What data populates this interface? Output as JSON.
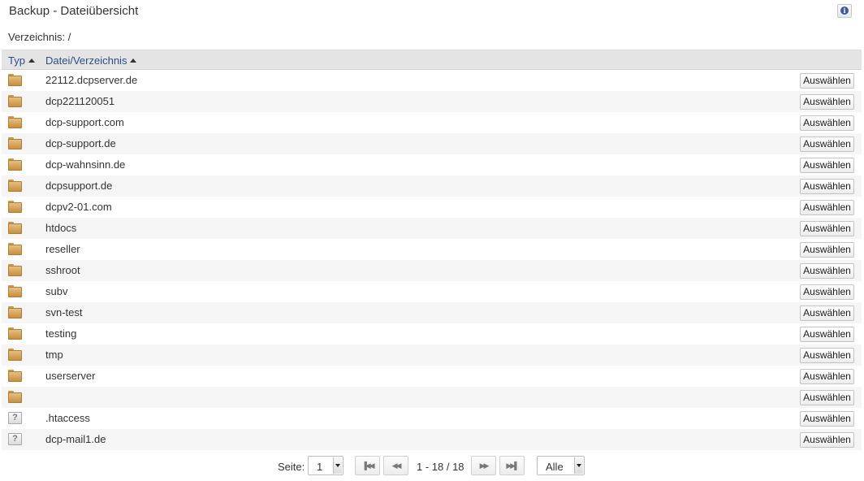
{
  "header": {
    "title": "Backup - Dateiübersicht",
    "info_icon": "info-icon"
  },
  "directory": {
    "text": "Verzeichnis: /"
  },
  "table": {
    "columns": [
      "Typ",
      "Datei/Verzeichnis"
    ],
    "rows": [
      {
        "type": "folder",
        "name": "22112.dcpserver.de",
        "action": "Auswählen"
      },
      {
        "type": "folder",
        "name": "dcp221120051",
        "action": "Auswählen"
      },
      {
        "type": "folder",
        "name": "dcp-support.com",
        "action": "Auswählen"
      },
      {
        "type": "folder",
        "name": "dcp-support.de",
        "action": "Auswählen"
      },
      {
        "type": "folder",
        "name": "dcp-wahnsinn.de",
        "action": "Auswählen"
      },
      {
        "type": "folder",
        "name": "dcpsupport.de",
        "action": "Auswählen"
      },
      {
        "type": "folder",
        "name": "dcpv2-01.com",
        "action": "Auswählen"
      },
      {
        "type": "folder",
        "name": "htdocs",
        "action": "Auswählen"
      },
      {
        "type": "folder",
        "name": "reseller",
        "action": "Auswählen"
      },
      {
        "type": "folder",
        "name": "sshroot",
        "action": "Auswählen"
      },
      {
        "type": "folder",
        "name": "subv",
        "action": "Auswählen"
      },
      {
        "type": "folder",
        "name": "svn-test",
        "action": "Auswählen"
      },
      {
        "type": "folder",
        "name": "testing",
        "action": "Auswählen"
      },
      {
        "type": "folder",
        "name": "tmp",
        "action": "Auswählen"
      },
      {
        "type": "folder",
        "name": "userserver",
        "action": "Auswählen"
      },
      {
        "type": "folder",
        "name": "",
        "action": "Auswählen"
      },
      {
        "type": "unknown",
        "name": ".htaccess",
        "action": "Auswählen"
      },
      {
        "type": "unknown",
        "name": "dcp-mail1.de",
        "action": "Auswählen"
      }
    ]
  },
  "pager": {
    "page_label": "Seite:",
    "page_value": "1",
    "info": "1 - 18 / 18",
    "size_value": "Alle",
    "first_icon": "first-page-icon",
    "prev_icon": "prev-page-icon",
    "next_icon": "next-page-icon",
    "last_icon": "last-page-icon"
  }
}
